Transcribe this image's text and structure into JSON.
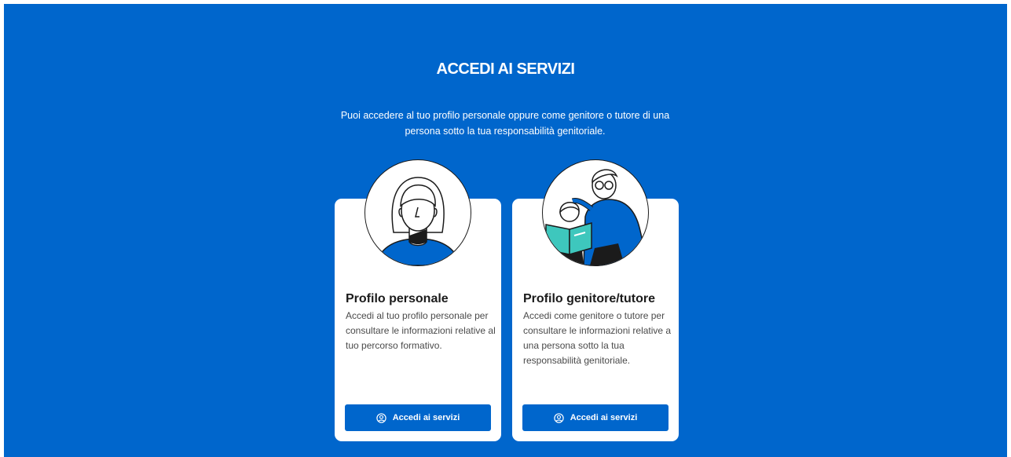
{
  "header": {
    "title": "ACCEDI AI SERVIZI",
    "subtitle": "Puoi accedere al tuo profilo personale oppure come genitore o tutore di una persona sotto la tua responsabilità genitoriale."
  },
  "cards": [
    {
      "title": "Profilo personale",
      "description": "Accedi al tuo profilo personale per consultare le informazioni relative al tuo percorso formativo.",
      "button_label": "Accedi ai servizi",
      "button_icon": "user-circle-icon",
      "illustration": "person-portrait-illustration"
    },
    {
      "title": "Profilo genitore/tutore",
      "description": "Accedi come genitore o tutore per consultare le informazioni relative a una persona sotto la tua responsabilità genitoriale.",
      "button_label": "Accedi ai servizi",
      "button_icon": "user-circle-icon",
      "illustration": "parent-and-child-reading-illustration"
    }
  ],
  "colors": {
    "brand_blue": "#0066cc",
    "card_background": "#ffffff",
    "illustration_teal": "#3ec7bd"
  }
}
